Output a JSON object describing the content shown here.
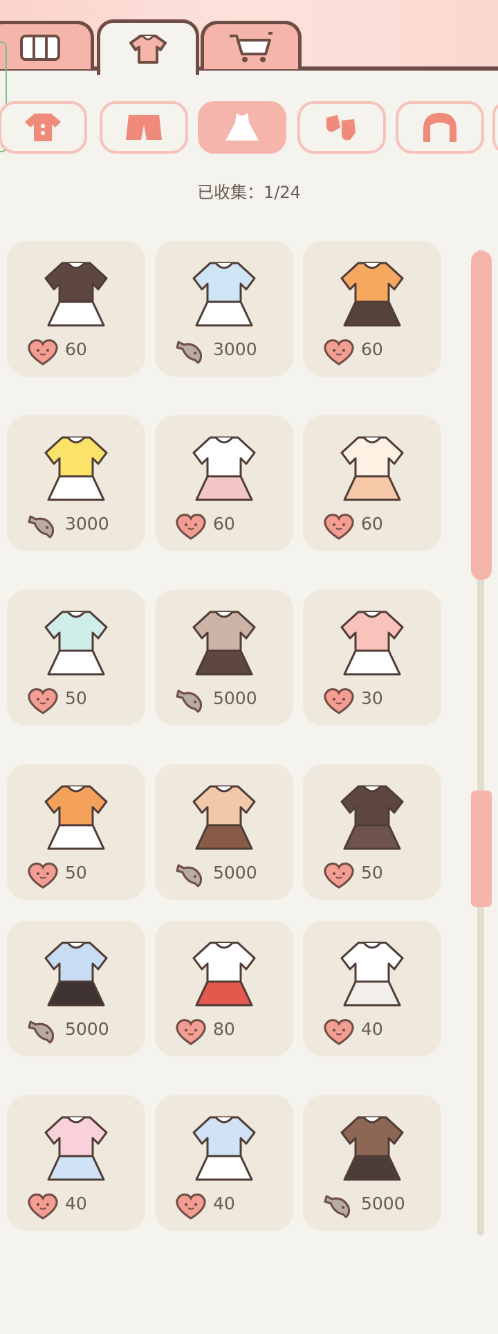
{
  "tabs": [
    {
      "name": "wardrobe-tab",
      "icon": "wardrobe-icon"
    },
    {
      "name": "clothes-tab",
      "icon": "shirt-icon"
    },
    {
      "name": "shop-tab",
      "icon": "cart-icon"
    }
  ],
  "categories": [
    {
      "name": "tops",
      "icon": "top-icon"
    },
    {
      "name": "bottoms",
      "icon": "shorts-icon"
    },
    {
      "name": "dresses",
      "icon": "dress-icon"
    },
    {
      "name": "socks",
      "icon": "socks-icon"
    },
    {
      "name": "hair",
      "icon": "hair-icon"
    }
  ],
  "collected": {
    "text": "已收集：1/24"
  },
  "items": [
    {
      "price": "60",
      "currency": "heart",
      "outfit": "brown-pinafore"
    },
    {
      "price": "3000",
      "currency": "fish",
      "outfit": "blue-white-dress"
    },
    {
      "price": "60",
      "currency": "heart",
      "outfit": "orange-top-dark-skirt"
    },
    {
      "price": "3000",
      "currency": "fish",
      "outfit": "yellow-floral-dress"
    },
    {
      "price": "60",
      "currency": "heart",
      "outfit": "white-floral-dress"
    },
    {
      "price": "60",
      "currency": "heart",
      "outfit": "cream-peach-dress"
    },
    {
      "price": "50",
      "currency": "heart",
      "outfit": "mint-qipao"
    },
    {
      "price": "5000",
      "currency": "fish",
      "outfit": "brown-uniform"
    },
    {
      "price": "30",
      "currency": "heart",
      "outfit": "pink-collar-dress"
    },
    {
      "price": "50",
      "currency": "heart",
      "outfit": "orange-apron-dress"
    },
    {
      "price": "5000",
      "currency": "fish",
      "outfit": "peach-bow-dress"
    },
    {
      "price": "50",
      "currency": "heart",
      "outfit": "dark-brown-dress"
    },
    {
      "price": "5000",
      "currency": "fish",
      "outfit": "blue-suit"
    },
    {
      "price": "80",
      "currency": "heart",
      "outfit": "red-bow-white-dress"
    },
    {
      "price": "40",
      "currency": "heart",
      "outfit": "white-shawl-dress"
    },
    {
      "price": "40",
      "currency": "heart",
      "outfit": "pastel-tracksuit"
    },
    {
      "price": "40",
      "currency": "heart",
      "outfit": "blue-outfit-bag"
    },
    {
      "price": "5000",
      "currency": "fish",
      "outfit": "brown-suit"
    }
  ],
  "colors": {
    "accent": "#f6b5ab",
    "outline": "#6e4d45",
    "card": "#efe8dc",
    "text": "#6b5a54"
  }
}
